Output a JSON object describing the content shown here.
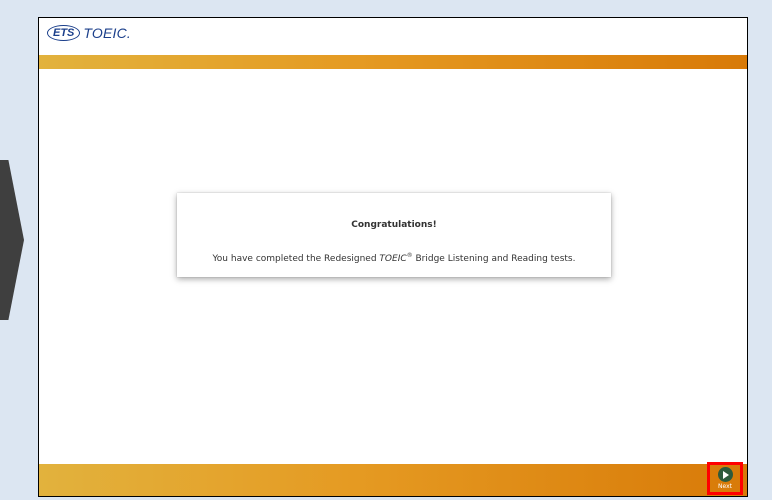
{
  "header": {
    "logo_ets": "ETS",
    "logo_toeic": "TOEIC."
  },
  "dialog": {
    "title": "Congratulations!",
    "message_prefix": "You have completed the Redesigned ",
    "message_brand": "TOEIC",
    "message_reg": "®",
    "message_suffix": " Bridge Listening and Reading tests."
  },
  "footer": {
    "next_label": "Next",
    "next_icon": "play-circle-icon"
  },
  "colors": {
    "brand_blue": "#1b3f8b",
    "bar_gradient_start": "#e2b23d",
    "bar_gradient_end": "#d87a08",
    "highlight_red": "#ff0000",
    "next_button_green": "#2d5a3c",
    "page_background": "#dce6f2"
  }
}
